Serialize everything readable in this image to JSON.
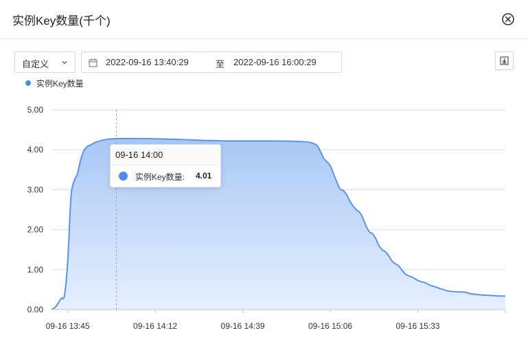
{
  "dialog": {
    "title": "实例Key数量(千个)"
  },
  "toolbar": {
    "range_select": {
      "value": "自定义"
    },
    "date_range": {
      "start": "2022-09-16 13:40:29",
      "separator": "至",
      "end": "2022-09-16 16:00:29"
    }
  },
  "icons": {
    "close": "close-circle-icon",
    "chevron": "chevron-down-icon",
    "calendar": "calendar-icon",
    "download": "download-icon"
  },
  "colors": {
    "accent": "#4a8af4",
    "line": "#5a93e8",
    "grid": "#d8dce8"
  },
  "chart_data": {
    "type": "area",
    "legend": {
      "label": "实例Key数量",
      "placement": "top-left"
    },
    "ylim": [
      0,
      5
    ],
    "y_ticks": [
      "0.00",
      "1.00",
      "2.00",
      "3.00",
      "4.00",
      "5.00"
    ],
    "x_tick_labels": [
      "09-16 13:45",
      "09-16 14:12",
      "09-16 14:39",
      "09-16 15:06",
      "09-16 15:33"
    ],
    "x_range_minutes": [
      0,
      140
    ],
    "x_ticks_minutes": [
      5,
      32,
      59,
      86,
      113
    ],
    "grid": true,
    "series": [
      {
        "name": "实例Key数量",
        "points": [
          [
            0,
            0.0
          ],
          [
            1,
            0.05
          ],
          [
            2,
            0.15
          ],
          [
            3,
            0.28
          ],
          [
            4,
            0.35
          ],
          [
            5,
            1.2
          ],
          [
            6,
            2.8
          ],
          [
            7,
            3.22
          ],
          [
            8,
            3.4
          ],
          [
            9,
            3.75
          ],
          [
            10,
            3.98
          ],
          [
            11,
            4.08
          ],
          [
            12,
            4.12
          ],
          [
            14,
            4.2
          ],
          [
            17,
            4.26
          ],
          [
            21,
            4.28
          ],
          [
            28,
            4.28
          ],
          [
            35,
            4.27
          ],
          [
            42,
            4.25
          ],
          [
            49,
            4.23
          ],
          [
            56,
            4.22
          ],
          [
            63,
            4.22
          ],
          [
            70,
            4.22
          ],
          [
            75,
            4.21
          ],
          [
            78,
            4.2
          ],
          [
            80,
            4.18
          ],
          [
            81,
            4.15
          ],
          [
            82,
            4.1
          ],
          [
            83,
            3.95
          ],
          [
            84,
            3.78
          ],
          [
            85,
            3.7
          ],
          [
            86,
            3.6
          ],
          [
            87,
            3.4
          ],
          [
            88,
            3.2
          ],
          [
            89,
            3.02
          ],
          [
            90,
            2.98
          ],
          [
            91,
            2.88
          ],
          [
            92,
            2.72
          ],
          [
            93,
            2.6
          ],
          [
            94,
            2.5
          ],
          [
            95,
            2.44
          ],
          [
            96,
            2.3
          ],
          [
            97,
            2.1
          ],
          [
            98,
            1.95
          ],
          [
            99,
            1.9
          ],
          [
            100,
            1.78
          ],
          [
            101,
            1.6
          ],
          [
            102,
            1.5
          ],
          [
            103,
            1.45
          ],
          [
            104,
            1.35
          ],
          [
            105,
            1.22
          ],
          [
            106,
            1.15
          ],
          [
            107,
            1.1
          ],
          [
            108,
            1.0
          ],
          [
            109,
            0.9
          ],
          [
            110,
            0.85
          ],
          [
            111,
            0.82
          ],
          [
            112,
            0.78
          ],
          [
            113,
            0.73
          ],
          [
            114,
            0.7
          ],
          [
            115,
            0.68
          ],
          [
            116,
            0.64
          ],
          [
            117,
            0.6
          ],
          [
            118,
            0.58
          ],
          [
            119,
            0.55
          ],
          [
            120,
            0.52
          ],
          [
            121,
            0.5
          ],
          [
            122,
            0.47
          ],
          [
            123,
            0.46
          ],
          [
            124,
            0.45
          ],
          [
            126,
            0.44
          ],
          [
            127,
            0.44
          ],
          [
            128,
            0.43
          ],
          [
            129,
            0.4
          ],
          [
            131,
            0.38
          ],
          [
            132,
            0.37
          ],
          [
            134,
            0.36
          ],
          [
            136,
            0.35
          ],
          [
            138,
            0.34
          ],
          [
            140,
            0.34
          ]
        ]
      }
    ],
    "tooltip": {
      "time": "09-16 14:00",
      "series_label": "实例Key数量:",
      "value": "4.01",
      "x_minutes": 20,
      "y": 4.01
    }
  }
}
